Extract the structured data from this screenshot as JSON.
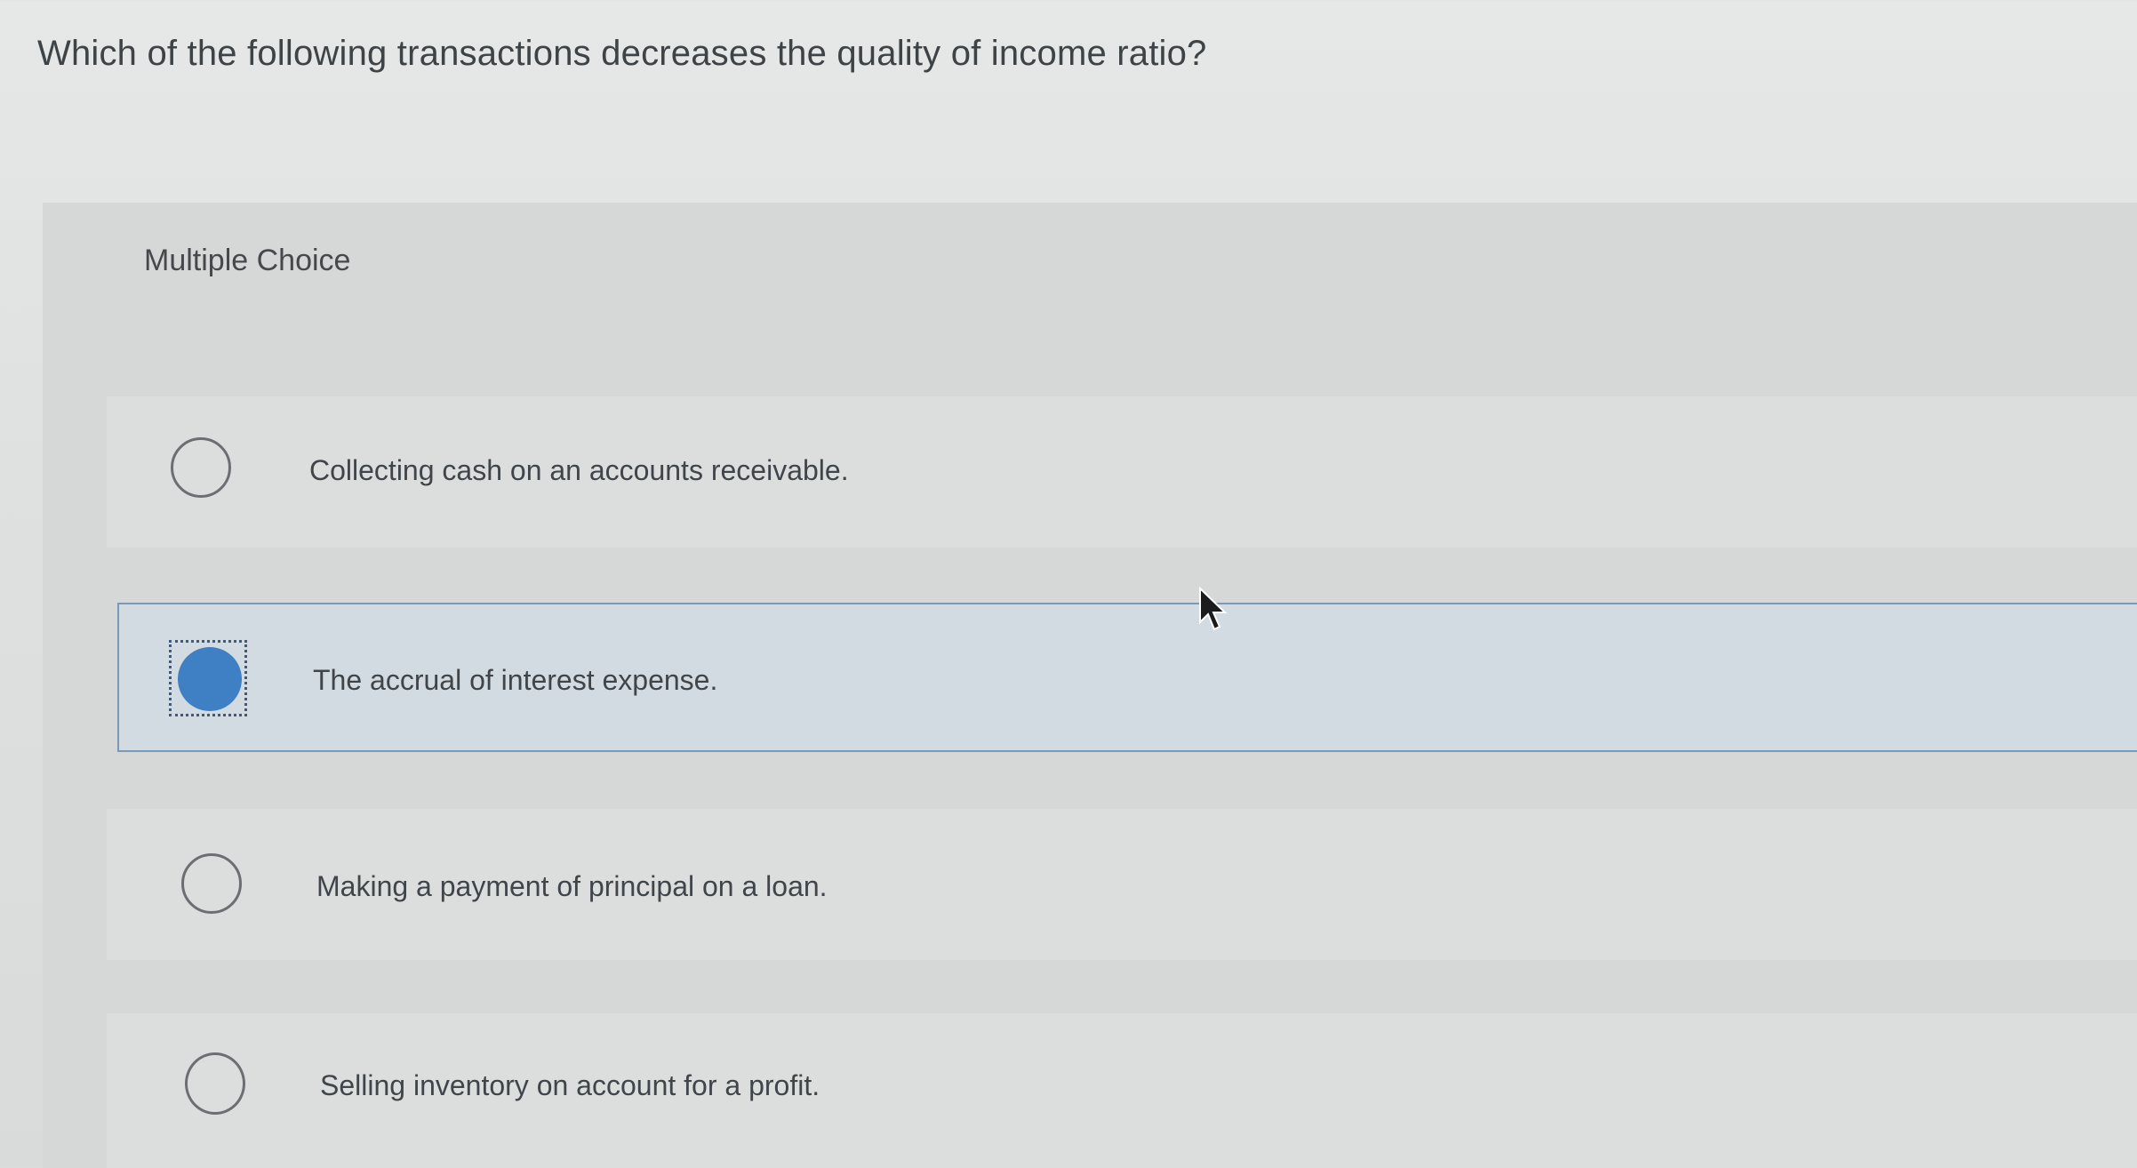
{
  "question": {
    "text": "Which of the following transactions decreases the quality of income ratio?"
  },
  "section": {
    "label": "Multiple Choice"
  },
  "options": [
    {
      "label": "Collecting cash on an accounts receivable.",
      "selected": false
    },
    {
      "label": "The accrual of interest expense.",
      "selected": true
    },
    {
      "label": "Making a payment of principal on a loan.",
      "selected": false
    },
    {
      "label": "Selling inventory on account for a profit.",
      "selected": false
    }
  ],
  "colors": {
    "selected_fill": "#3f7fc4",
    "selected_border": "#7b98b5",
    "selected_background": "#d3dbe2"
  },
  "icons": {
    "cursor": "mouse-pointer-icon",
    "radio": "radio-button-icon"
  }
}
